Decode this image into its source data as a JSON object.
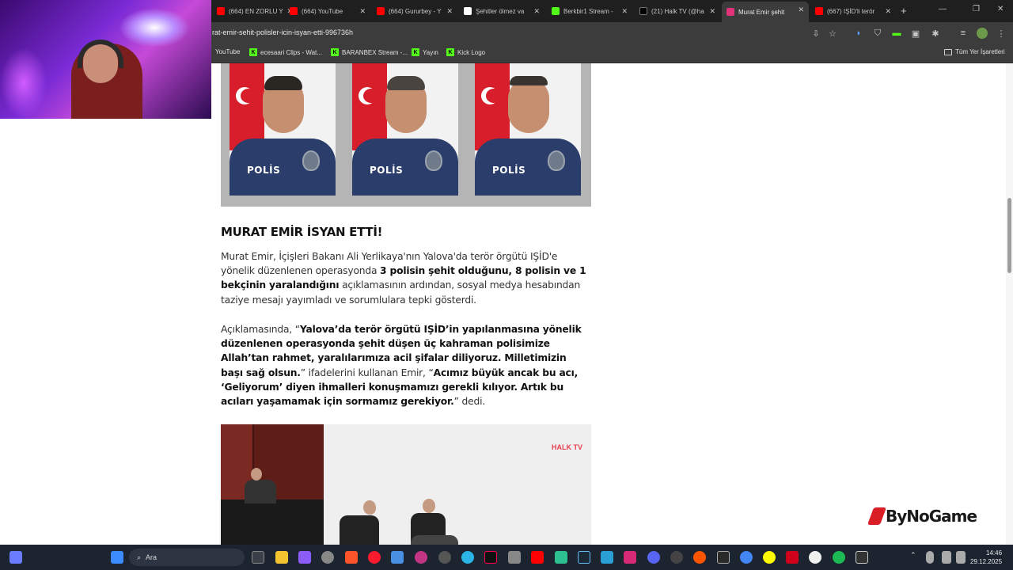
{
  "tabs": [
    {
      "title": "(664) EN ZORLU Y",
      "fav": "#ff0000"
    },
    {
      "title": "(664) YouTube",
      "fav": "#ff0000"
    },
    {
      "title": "(664) Gururbey - Y",
      "fav": "#ff0000"
    },
    {
      "title": "Şehitler ölmez va",
      "fav": "#ffffff"
    },
    {
      "title": "Berkbir1 Stream -",
      "fav": "#53fc18"
    },
    {
      "title": "(21) Halk TV (@ha",
      "fav": "#000000"
    },
    {
      "title": "Murat Emir şehit",
      "fav": "#e0337a"
    },
    {
      "title": "(667) IŞİD'li terör",
      "fav": "#ff0000"
    }
  ],
  "url": "rat-emir-sehit-polisler-icin-isyan-etti-996736h",
  "bookmarks": [
    {
      "label": "YouTube"
    },
    {
      "label": "ecesaari Clips - Wat..."
    },
    {
      "label": "BARANBEX Stream -..."
    },
    {
      "label": "Yayın"
    },
    {
      "label": "Kick Logo"
    }
  ],
  "all_bookmarks": "Tüm Yer İşaretleri",
  "article": {
    "officer_label": "POLİS",
    "heading": "MURAT EMİR İSYAN ETTİ!",
    "p1": {
      "t1": "Murat Emir, İçişleri Bakanı Ali Yerlikaya'nın Yalova'da terör örgütü IŞİD'e yönelik düzenlenen operasyonda ",
      "b1": "3 polisin şehit olduğunu, 8 polisin ve 1 bekçinin yaralandığını",
      "t2": " açıklamasının ardından, sosyal medya hesabından taziye mesajı yayımladı ve sorumlulara tepki gösterdi."
    },
    "p2": {
      "t1": "Açıklamasında, “",
      "b1": "Yalova’da terör örgütü IŞİD’in yapılanmasına yönelik düzenlenen operasyonda şehit düşen üç kahraman polisimize Allah’tan rahmet, yaralılarımıza acil şifalar diliyoruz. Milletimizin başı sağ olsun.",
      "t2": "” ifadelerini kullanan Emir, “",
      "b2": "Acımız büyük ancak bu acı, ‘Geliyorum’ diyen ihmalleri konuşmamızı gerekli kılıyor. Artık bu acıları yaşamamak için sormamız gerekiyor.",
      "t3": "” dedi."
    },
    "watermark": "HALK TV"
  },
  "brand": "ByNoGame",
  "taskbar": {
    "search_placeholder": "Ara",
    "time": "14:46",
    "date": "29.12.2025"
  }
}
